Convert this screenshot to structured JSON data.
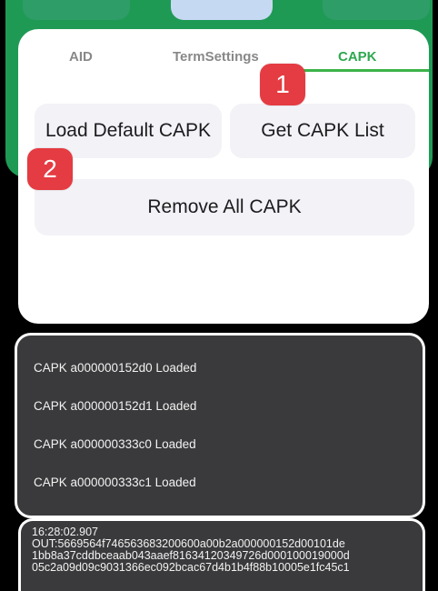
{
  "tabs": {
    "aid": "AID",
    "term": "TermSettings",
    "capk": "CAPK"
  },
  "buttons": {
    "load_default": "Load Default CAPK",
    "get_list": "Get CAPK List",
    "remove_all": "Remove All CAPK"
  },
  "badges": {
    "one": "1",
    "two": "2"
  },
  "log": [
    "CAPK a000000152d0 Loaded",
    "CAPK a000000152d1 Loaded",
    "CAPK a000000333c0 Loaded",
    "CAPK a000000333c1 Loaded"
  ],
  "output": {
    "time": "16:28:02.907",
    "line1": "OUT:5669564f746563683200600a00b2a000000152d00101de",
    "line2": "1bb8a37cddbceaab043aaef81634120349726d000100019000d",
    "line3": "05c2a09d09c9031366ec092bcac67d4b1b4f88b10005e1fc45c1"
  },
  "colors": {
    "accent_green": "#2fa84f",
    "badge_red": "#e43c42"
  }
}
